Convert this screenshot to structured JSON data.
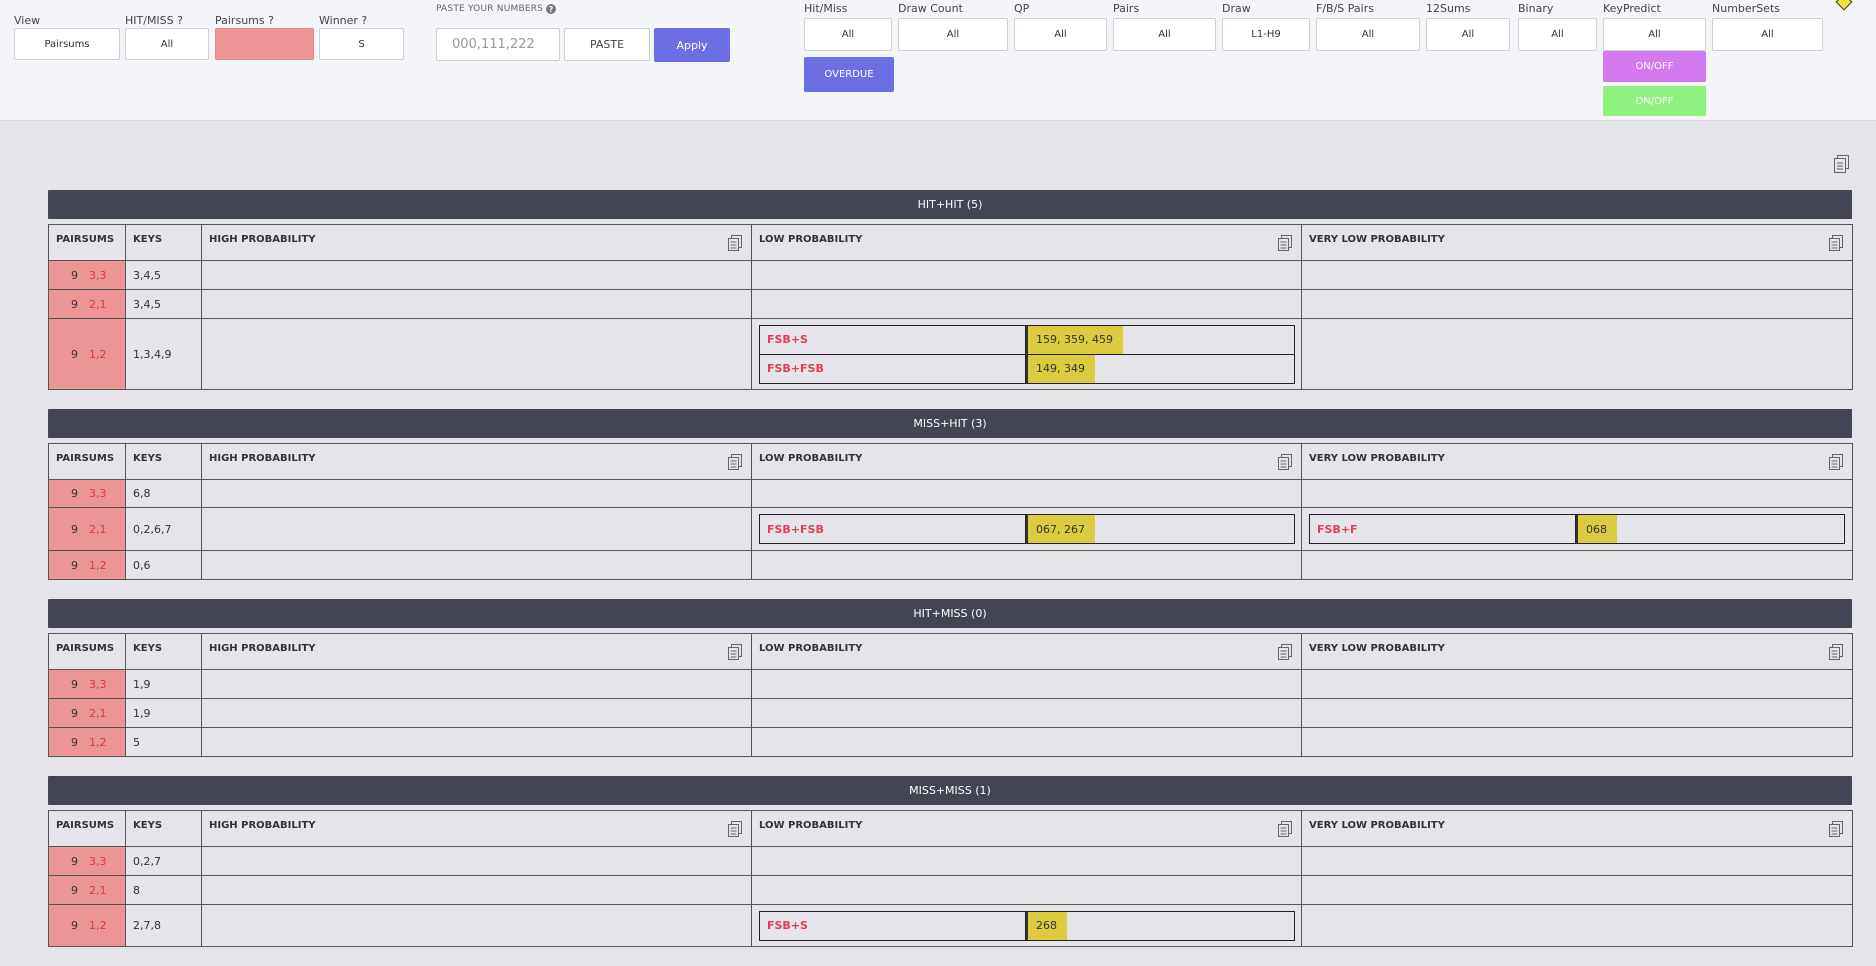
{
  "filters": {
    "view": {
      "label": "View",
      "value": "Pairsums"
    },
    "hitmiss": {
      "label": "HIT/MISS ?",
      "value": "All"
    },
    "pairsums": {
      "label": "Pairsums ?",
      "value": ""
    },
    "winner": {
      "label": "Winner ?",
      "value": "S"
    },
    "paste": {
      "label": "PASTE YOUR NUMBERS",
      "placeholder": "000,111,222",
      "paste_button": "PASTE",
      "apply_button": "Apply"
    }
  },
  "top_filters": [
    {
      "label": "Hit/Miss",
      "value": "All"
    },
    {
      "label": "Draw Count",
      "value": "All"
    },
    {
      "label": "QP",
      "value": "All"
    },
    {
      "label": "Pairs",
      "value": "All"
    },
    {
      "label": "Draw",
      "value": "L1-H9"
    },
    {
      "label": "F/B/S Pairs",
      "value": "All"
    },
    {
      "label": "12Sums",
      "value": "All"
    },
    {
      "label": "Binary",
      "value": "All"
    },
    {
      "label": "KeyPredict",
      "value": "All"
    },
    {
      "label": "NumberSets",
      "value": "All"
    }
  ],
  "buttons": {
    "overdue": "OVERDUE",
    "onoff_1": "ON/OFF",
    "onoff_2": "ON/OFF"
  },
  "columns": {
    "pairsums": "PAIRSUMS",
    "keys": "KEYS",
    "high": "HIGH PROBABILITY",
    "low": "LOW PROBABILITY",
    "very_low": "VERY LOW PROBABILITY"
  },
  "sections": [
    {
      "title": "HIT+HIT (5)",
      "rows": [
        {
          "ps": "9",
          "pr": "3,3",
          "keys": "3,4,5",
          "high": [],
          "low": [],
          "vlow": []
        },
        {
          "ps": "9",
          "pr": "2,1",
          "keys": "3,4,5",
          "high": [],
          "low": [],
          "vlow": []
        },
        {
          "ps": "9",
          "pr": "1,2",
          "keys": "1,3,4,9",
          "high": [],
          "low": [
            {
              "label": "FSB+S",
              "value": "159, 359, 459"
            },
            {
              "label": "FSB+FSB",
              "value": "149, 349"
            }
          ],
          "vlow": []
        }
      ]
    },
    {
      "title": "MISS+HIT (3)",
      "rows": [
        {
          "ps": "9",
          "pr": "3,3",
          "keys": "6,8",
          "high": [],
          "low": [],
          "vlow": []
        },
        {
          "ps": "9",
          "pr": "2,1",
          "keys": "0,2,6,7",
          "high": [],
          "low": [
            {
              "label": "FSB+FSB",
              "value": "067, 267"
            }
          ],
          "vlow": [
            {
              "label": "FSB+F",
              "value": "068"
            }
          ]
        },
        {
          "ps": "9",
          "pr": "1,2",
          "keys": "0,6",
          "high": [],
          "low": [],
          "vlow": []
        }
      ]
    },
    {
      "title": "HIT+MISS (0)",
      "rows": [
        {
          "ps": "9",
          "pr": "3,3",
          "keys": "1,9",
          "high": [],
          "low": [],
          "vlow": []
        },
        {
          "ps": "9",
          "pr": "2,1",
          "keys": "1,9",
          "high": [],
          "low": [],
          "vlow": []
        },
        {
          "ps": "9",
          "pr": "1,2",
          "keys": "5",
          "high": [],
          "low": [],
          "vlow": []
        }
      ]
    },
    {
      "title": "MISS+MISS (1)",
      "rows": [
        {
          "ps": "9",
          "pr": "3,3",
          "keys": "0,2,7",
          "high": [],
          "low": [],
          "vlow": []
        },
        {
          "ps": "9",
          "pr": "2,1",
          "keys": "8",
          "high": [],
          "low": [],
          "vlow": []
        },
        {
          "ps": "9",
          "pr": "1,2",
          "keys": "2,7,8",
          "high": [],
          "low": [
            {
              "label": "FSB+S",
              "value": "268"
            }
          ],
          "vlow": []
        }
      ]
    }
  ],
  "colors": {
    "accent": "#6b6fe2",
    "pairsum_bg": "#ec9595",
    "highlight": "#dccb3f",
    "section_bar": "#434552",
    "label_red": "#e0415a"
  }
}
